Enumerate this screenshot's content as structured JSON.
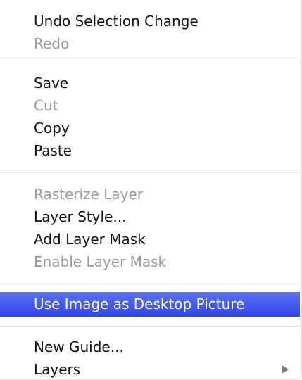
{
  "menu": {
    "items": [
      {
        "label": "Undo Selection Change",
        "enabled": true
      },
      {
        "label": "Redo",
        "enabled": false
      },
      {
        "label": "Save",
        "enabled": true
      },
      {
        "label": "Cut",
        "enabled": false
      },
      {
        "label": "Copy",
        "enabled": true
      },
      {
        "label": "Paste",
        "enabled": true
      },
      {
        "label": "Rasterize Layer",
        "enabled": false
      },
      {
        "label": "Layer Style...",
        "enabled": true
      },
      {
        "label": "Add Layer Mask",
        "enabled": true
      },
      {
        "label": "Enable Layer Mask",
        "enabled": false
      },
      {
        "label": "Use Image as Desktop Picture",
        "enabled": true,
        "highlighted": true
      },
      {
        "label": "New Guide...",
        "enabled": true
      },
      {
        "label": "Layers",
        "enabled": true,
        "submenu_icon": "submenu-arrow-icon"
      }
    ]
  },
  "colors": {
    "highlight": "#3a50ee",
    "enabled_text": "#111111",
    "disabled_text": "#9a9a9a",
    "separator": "#e4e4e4"
  }
}
